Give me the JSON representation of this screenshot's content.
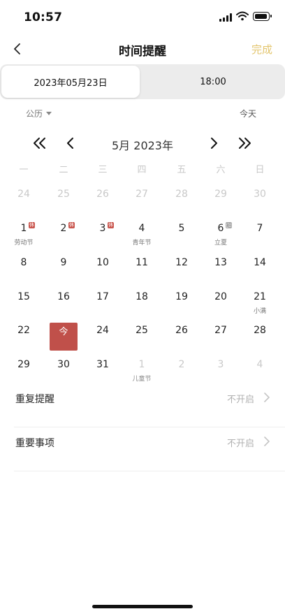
{
  "status_bar": {
    "time": "10:57"
  },
  "nav": {
    "title": "时间提醒",
    "done_label": "完成"
  },
  "segment": {
    "date_value": "2023年05月23日",
    "time_value": "18:00"
  },
  "calendar": {
    "type_label": "公历",
    "today_label": "今天",
    "month_title": "5月 2023年",
    "weekdays": [
      "一",
      "二",
      "三",
      "四",
      "五",
      "六",
      "日"
    ],
    "weeks": [
      [
        {
          "d": "24",
          "muted": true
        },
        {
          "d": "25",
          "muted": true
        },
        {
          "d": "26",
          "muted": true
        },
        {
          "d": "27",
          "muted": true
        },
        {
          "d": "28",
          "muted": true
        },
        {
          "d": "29",
          "muted": true
        },
        {
          "d": "30",
          "muted": true
        }
      ],
      [
        {
          "d": "1",
          "sub": "劳动节",
          "badge": "休",
          "badge_type": "rest"
        },
        {
          "d": "2",
          "badge": "休",
          "badge_type": "rest"
        },
        {
          "d": "3",
          "badge": "休",
          "badge_type": "rest"
        },
        {
          "d": "4",
          "sub": "青年节"
        },
        {
          "d": "5"
        },
        {
          "d": "6",
          "sub": "立夏",
          "badge": "班",
          "badge_type": "work"
        },
        {
          "d": "7"
        }
      ],
      [
        {
          "d": "8"
        },
        {
          "d": "9"
        },
        {
          "d": "10"
        },
        {
          "d": "11"
        },
        {
          "d": "12"
        },
        {
          "d": "13"
        },
        {
          "d": "14"
        }
      ],
      [
        {
          "d": "15"
        },
        {
          "d": "16"
        },
        {
          "d": "17"
        },
        {
          "d": "18"
        },
        {
          "d": "19"
        },
        {
          "d": "20"
        },
        {
          "d": "21",
          "sub": "小满"
        }
      ],
      [
        {
          "d": "22"
        },
        {
          "d": "今",
          "today": true
        },
        {
          "d": "24"
        },
        {
          "d": "25"
        },
        {
          "d": "26"
        },
        {
          "d": "27"
        },
        {
          "d": "28"
        }
      ],
      [
        {
          "d": "29"
        },
        {
          "d": "30"
        },
        {
          "d": "31"
        },
        {
          "d": "1",
          "muted": true,
          "sub": "儿童节"
        },
        {
          "d": "2",
          "muted": true
        },
        {
          "d": "3",
          "muted": true
        },
        {
          "d": "4",
          "muted": true
        }
      ]
    ]
  },
  "settings": [
    {
      "label": "重复提醒",
      "value": "不开启"
    },
    {
      "label": "重要事项",
      "value": "不开启"
    }
  ],
  "colors": {
    "accent_gold": "#e3c56d",
    "today_red": "#c0504a",
    "rest_badge": "#c9554d"
  }
}
